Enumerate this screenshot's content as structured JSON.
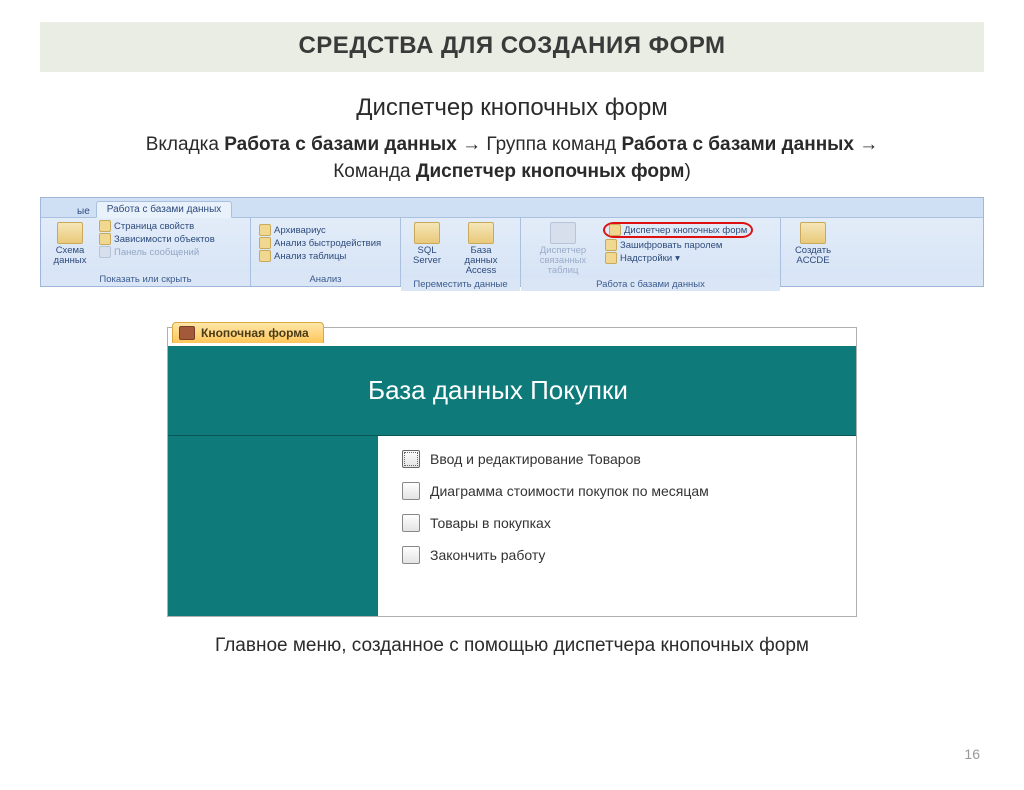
{
  "title": "СРЕДСТВА ДЛЯ СОЗДАНИЯ ФОРМ",
  "subtitle": "Диспетчер кнопочных форм",
  "nav": {
    "prefix": "Вкладка ",
    "b1": "Работа с базами данных",
    "arrow": " → ",
    "mid1": "Группа команд ",
    "b2": "Работа с базами данных",
    "mid2": "Команда ",
    "b3": "Диспетчер кнопочных форм",
    "close": ")"
  },
  "ribbon": {
    "tab_frag": "ые",
    "tab_active": "Работа с базами данных",
    "g1": {
      "big": "Схема данных",
      "m1": "Страница свойств",
      "m2": "Зависимости объектов",
      "m3": "Панель сообщений",
      "label": "Показать или скрыть"
    },
    "g2": {
      "m1": "Архивариус",
      "m2": "Анализ быстродействия",
      "m3": "Анализ таблицы",
      "label": "Анализ"
    },
    "g3": {
      "b1": "SQL Server",
      "b2": "База данных Access",
      "label": "Переместить данные"
    },
    "g4": {
      "big": "Диспетчер связанных таблиц",
      "m1": "Диспетчер кнопочных форм",
      "m2": "Зашифровать паролем",
      "m3": "Надстройки ",
      "label": "Работа с базами данных"
    },
    "g5": {
      "big": "Создать ACCDE"
    }
  },
  "form": {
    "tab": "Кнопочная форма",
    "header": "База данных Покупки",
    "buttons": [
      "Ввод и редактирование Товаров",
      "Диаграмма стоимости покупок по месяцам",
      "Товары в покупках",
      "Закончить работу"
    ]
  },
  "caption": "Главное меню, созданное с помощью диспетчера кнопочных форм",
  "page": "16"
}
